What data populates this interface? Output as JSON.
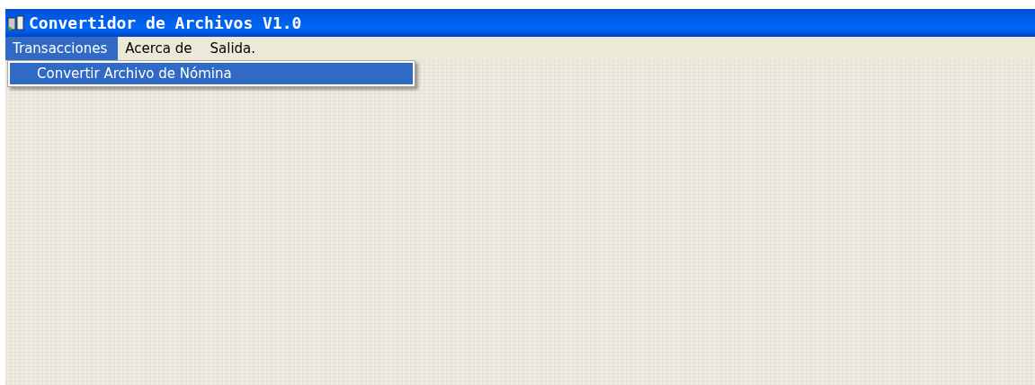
{
  "window": {
    "title": "Convertidor de Archivos V1.0"
  },
  "menu": [
    {
      "label": "Transacciones",
      "selected": true
    },
    {
      "label": "Acerca de",
      "selected": false
    },
    {
      "label": "Salida.",
      "selected": false
    }
  ],
  "dropdown": [
    {
      "label": "Convertir Archivo de Nómina",
      "selected": true
    }
  ]
}
